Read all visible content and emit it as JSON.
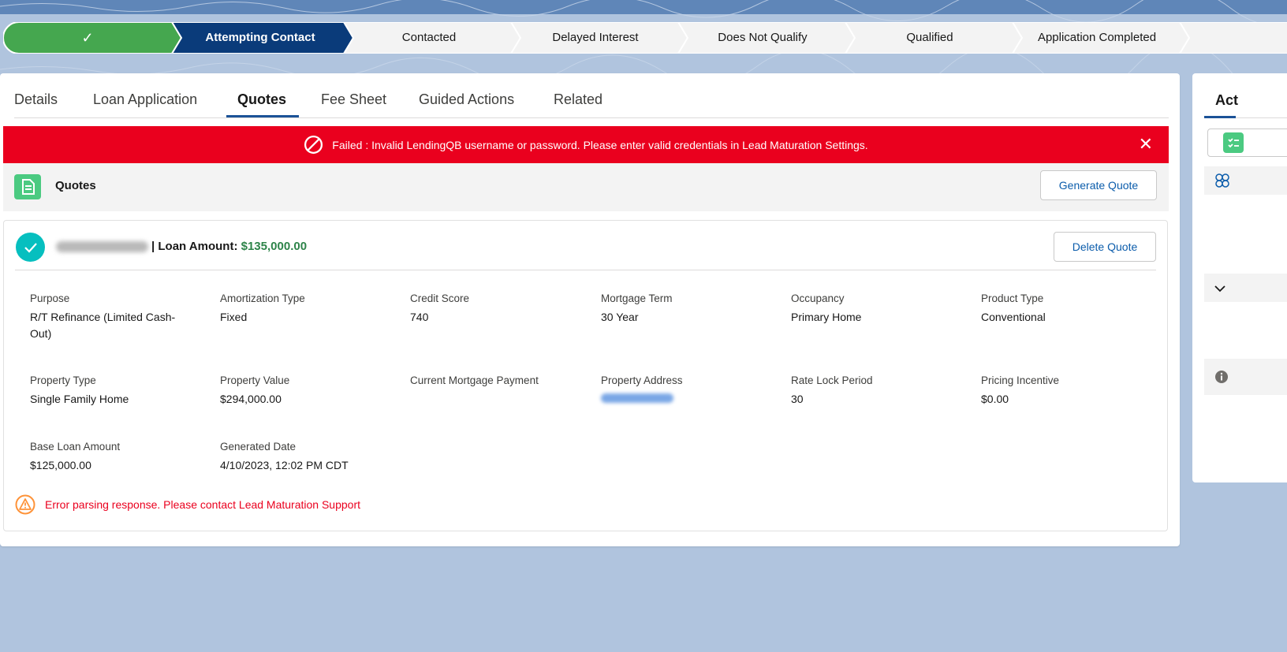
{
  "path": {
    "stages": [
      {
        "label": "✓",
        "status": "complete"
      },
      {
        "label": "Attempting Contact",
        "status": "current"
      },
      {
        "label": "Contacted",
        "status": "incomplete"
      },
      {
        "label": "Delayed Interest",
        "status": "incomplete"
      },
      {
        "label": "Does Not Qualify",
        "status": "incomplete"
      },
      {
        "label": "Qualified",
        "status": "incomplete"
      },
      {
        "label": "Application Completed",
        "status": "incomplete"
      }
    ],
    "colors": {
      "complete": "#45a74f",
      "current": "#0a3b7a",
      "incomplete": "#f3f3f3"
    }
  },
  "tabs": [
    {
      "label": "Details"
    },
    {
      "label": "Loan Application"
    },
    {
      "label": "Quotes",
      "active": true
    },
    {
      "label": "Fee Sheet"
    },
    {
      "label": "Guided Actions"
    },
    {
      "label": "Related"
    }
  ],
  "error_banner": {
    "message": "Failed : Invalid LendingQB username or password. Please enter valid credentials in Lead Maturation Settings.",
    "close": "✕"
  },
  "quotes_section": {
    "title": "Quotes",
    "generate_button": "Generate Quote"
  },
  "quote": {
    "amount_label": "| Loan Amount: ",
    "amount_value": "$135,000.00",
    "delete_button": "Delete Quote",
    "fields": [
      {
        "label": "Purpose",
        "value": "R/T Refinance (Limited Cash-Out)"
      },
      {
        "label": "Amortization Type",
        "value": "Fixed"
      },
      {
        "label": "Credit Score",
        "value": "740"
      },
      {
        "label": "Mortgage Term",
        "value": "30 Year"
      },
      {
        "label": "Occupancy",
        "value": "Primary Home"
      },
      {
        "label": "Product Type",
        "value": "Conventional"
      },
      {
        "label": "Property Type",
        "value": "Single Family Home"
      },
      {
        "label": "Property Value",
        "value": "$294,000.00"
      },
      {
        "label": "Current Mortgage Payment",
        "value": ""
      },
      {
        "label": "Property Address",
        "value": ""
      },
      {
        "label": "Rate Lock Period",
        "value": "30"
      },
      {
        "label": "Pricing Incentive",
        "value": "$0.00"
      },
      {
        "label": "Base Loan Amount",
        "value": "$125,000.00"
      },
      {
        "label": "Generated Date",
        "value": "4/10/2023, 12:02 PM CDT"
      }
    ],
    "warning": "Error parsing response. Please contact Lead Maturation Support"
  },
  "side_panel": {
    "title": "Act"
  }
}
